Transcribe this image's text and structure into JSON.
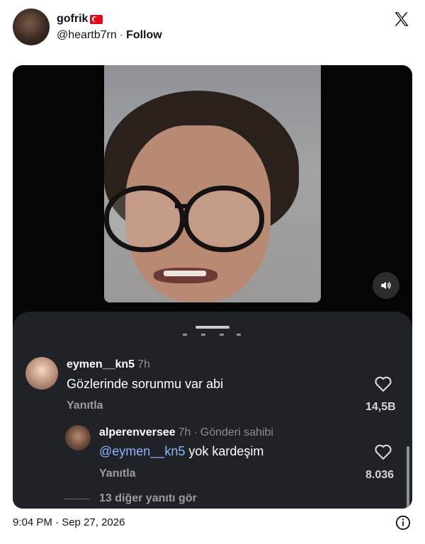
{
  "header": {
    "name": "gofrik",
    "handle": "@heartb7rn",
    "separator": "·",
    "follow_label": "Follow"
  },
  "comments": [
    {
      "username": "eymen__kn5",
      "time": "7h",
      "text": "Gözlerinde sorunmu var abi",
      "reply_label": "Yanıtla",
      "likes": "14,5B"
    },
    {
      "username": "alperenversee",
      "time": "7h",
      "separator": "·",
      "badge": "Gönderi sahibi",
      "mention": "@eymen__kn5",
      "text": " yok kardeşim",
      "reply_label": "Yanıtla",
      "likes": "8.036"
    }
  ],
  "more_replies": "13 diğer yanıtı gör",
  "footer": {
    "timestamp": "9:04 PM · Sep 27, 2026"
  },
  "colors": {
    "panel": "#1f2226",
    "mention": "#8eb6ff",
    "flag": "#e30a17"
  }
}
